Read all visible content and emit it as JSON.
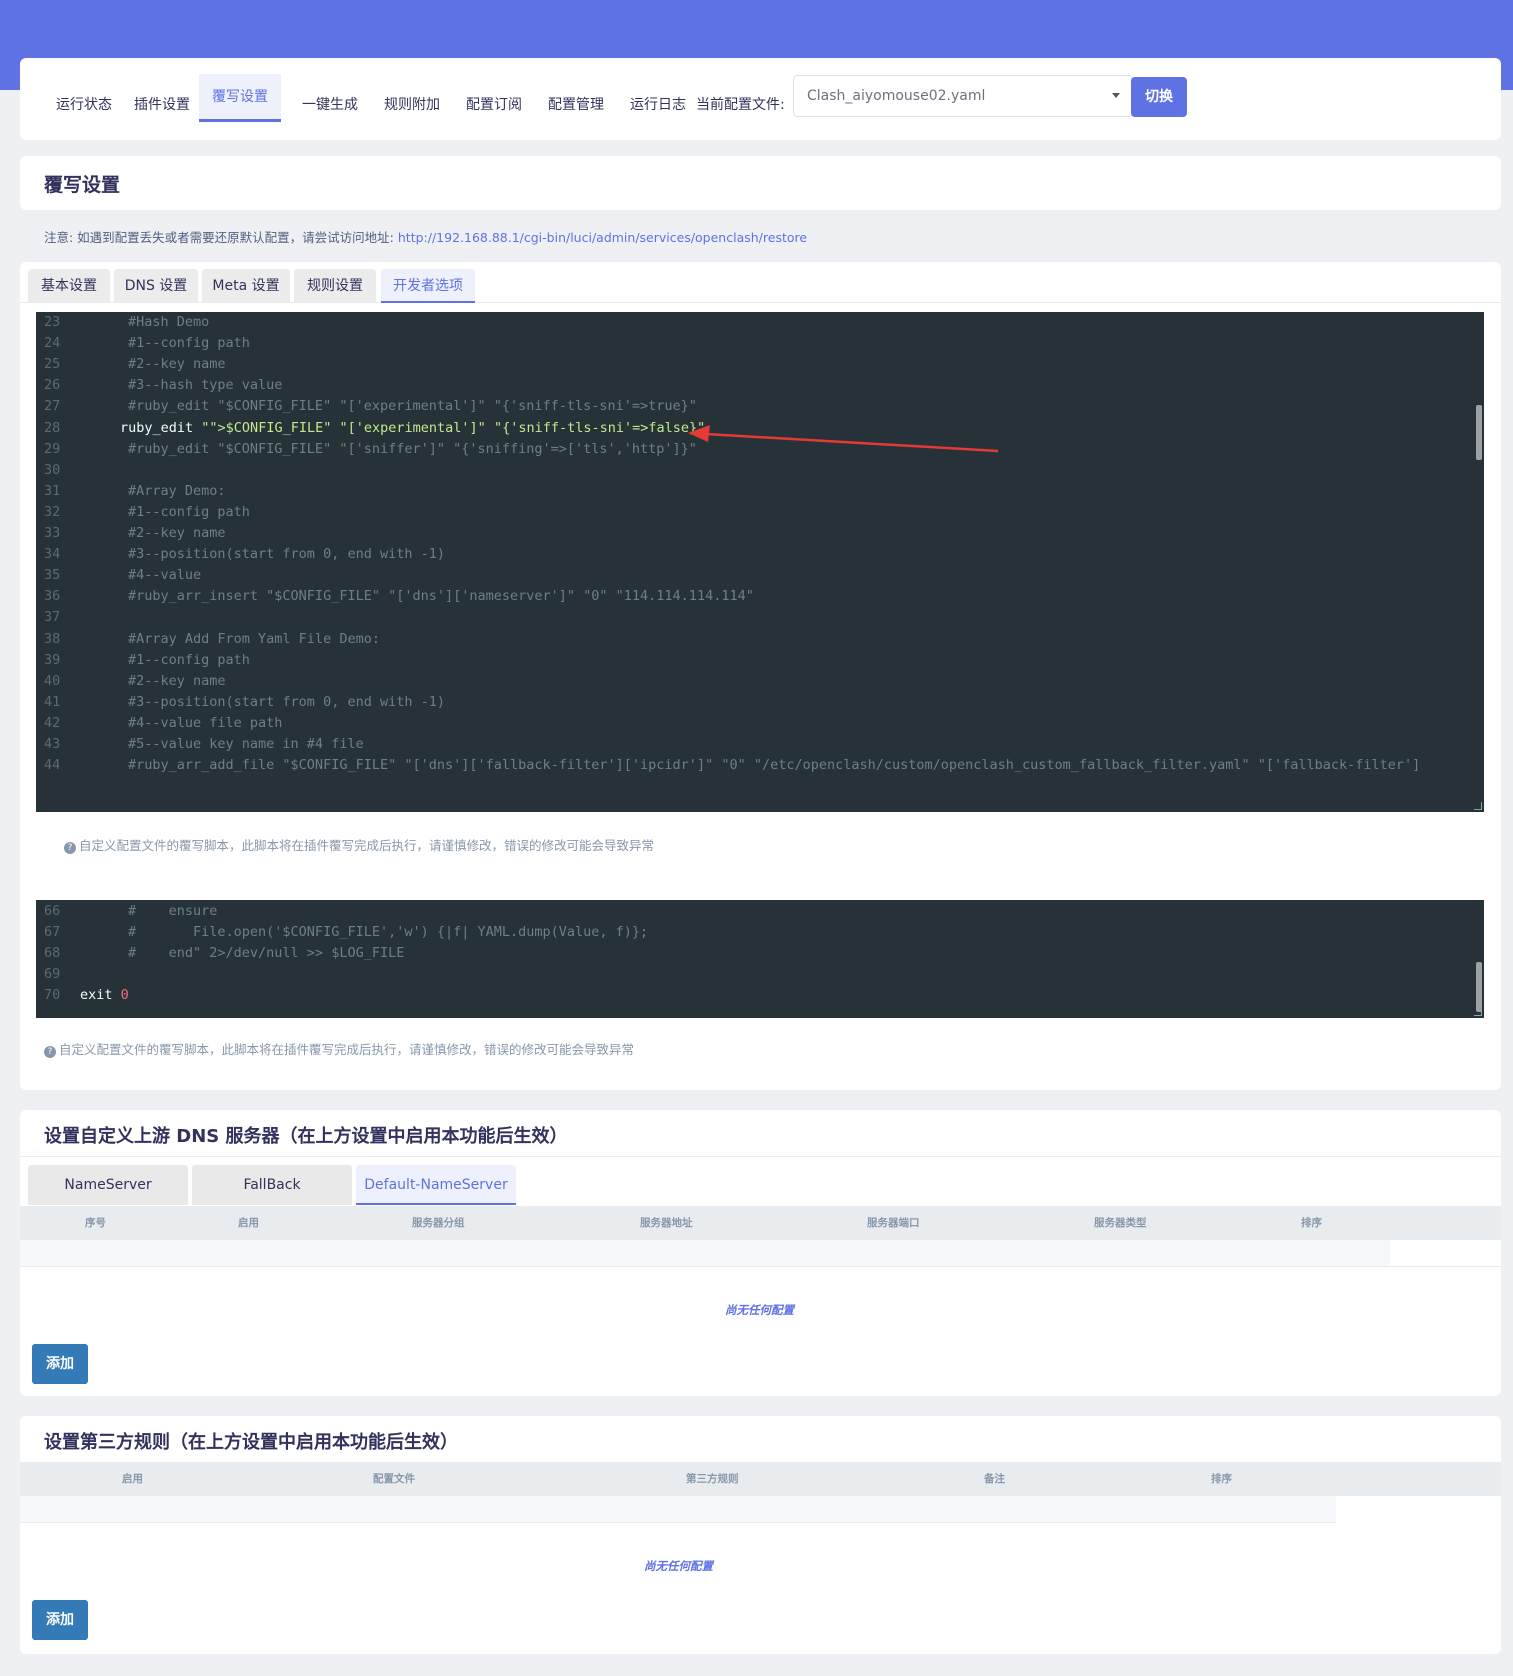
{
  "nav": {
    "items": [
      "运行状态",
      "插件设置",
      "覆写设置",
      "一键生成",
      "规则附加",
      "配置订阅",
      "配置管理",
      "运行日志"
    ],
    "active": "覆写设置",
    "config_label": "当前配置文件:",
    "config_value": "Clash_aiyomouse02.yaml",
    "switch_label": "切换"
  },
  "overwrite": {
    "title": "覆写设置",
    "notice_text": "注意: 如遇到配置丢失或者需要还原默认配置，请尝试访问地址: ",
    "notice_link": "http://192.168.88.1/cgi-bin/luci/admin/services/openclash/restore",
    "tabs": [
      "基本设置",
      "DNS 设置",
      "Meta 设置",
      "规则设置",
      "开发者选项"
    ],
    "active_tab": "开发者选项",
    "editor1_lines": [
      {
        "n": "23",
        "t": "#Hash Demo"
      },
      {
        "n": "24",
        "t": "#1--config path"
      },
      {
        "n": "25",
        "t": "#2--key name"
      },
      {
        "n": "26",
        "t": "#3--hash type value"
      },
      {
        "n": "27",
        "t": "#ruby_edit \"$CONFIG_FILE\" \"['experimental']\" \"{'sniff-tls-sni'=>true}\""
      },
      {
        "n": "28",
        "t": "ruby_edit \"$CONFIG_FILE\" \"['experimental']\" \"{'sniff-tls-sni'=>false}\""
      },
      {
        "n": "29",
        "t": "#ruby_edit \"$CONFIG_FILE\" \"['sniffer']\" \"{'sniffing'=>['tls','http']}\""
      },
      {
        "n": "30",
        "t": ""
      },
      {
        "n": "31",
        "t": "#Array Demo:"
      },
      {
        "n": "32",
        "t": "#1--config path"
      },
      {
        "n": "33",
        "t": "#2--key name"
      },
      {
        "n": "34",
        "t": "#3--position(start from 0, end with -1)"
      },
      {
        "n": "35",
        "t": "#4--value"
      },
      {
        "n": "36",
        "t": "#ruby_arr_insert \"$CONFIG_FILE\" \"['dns']['nameserver']\" \"0\" \"114.114.114.114\""
      },
      {
        "n": "37",
        "t": ""
      },
      {
        "n": "38",
        "t": "#Array Add From Yaml File Demo:"
      },
      {
        "n": "39",
        "t": "#1--config path"
      },
      {
        "n": "40",
        "t": "#2--key name"
      },
      {
        "n": "41",
        "t": "#3--position(start from 0, end with -1)"
      },
      {
        "n": "42",
        "t": "#4--value file path"
      },
      {
        "n": "43",
        "t": "#5--value key name in #4 file"
      },
      {
        "n": "44",
        "t": "#ruby_arr_add_file \"$CONFIG_FILE\" \"['dns']['fallback-filter']['ipcidr']\" \"0\" \"/etc/openclash/custom/openclash_custom_fallback_filter.yaml\" \"['fallback-filter']"
      }
    ],
    "editor2_lines": [
      {
        "n": "66",
        "t": "#    ensure"
      },
      {
        "n": "67",
        "t": "#       File.open('$CONFIG_FILE','w') {|f| YAML.dump(Value, f)};"
      },
      {
        "n": "68",
        "t": "#    end\" 2>/dev/null >> $LOG_FILE"
      },
      {
        "n": "69",
        "t": ""
      },
      {
        "n": "70",
        "t": "exit 0"
      }
    ],
    "help_text": "自定义配置文件的覆写脚本，此脚本将在插件覆写完成后执行，请谨慎修改，错误的修改可能会导致异常"
  },
  "dns": {
    "title": "设置自定义上游 DNS 服务器（在上方设置中启用本功能后生效）",
    "tabs": [
      "NameServer",
      "FallBack",
      "Default-NameServer"
    ],
    "active_tab": "Default-NameServer",
    "columns": [
      "序号",
      "启用",
      "服务器分组",
      "服务器地址",
      "服务器端口",
      "服务器类型",
      "排序"
    ],
    "empty_text": "尚无任何配置",
    "add_label": "添加"
  },
  "rules": {
    "title": "设置第三方规则（在上方设置中启用本功能后生效）",
    "columns": [
      "启用",
      "配置文件",
      "第三方规则",
      "备注",
      "排序"
    ],
    "empty_text": "尚无任何配置",
    "add_label": "添加"
  },
  "colors": {
    "accent": "#5e72e4",
    "editor_bg": "#263238",
    "add_button": "#337ab7",
    "annotation_arrow": "#e53935"
  }
}
